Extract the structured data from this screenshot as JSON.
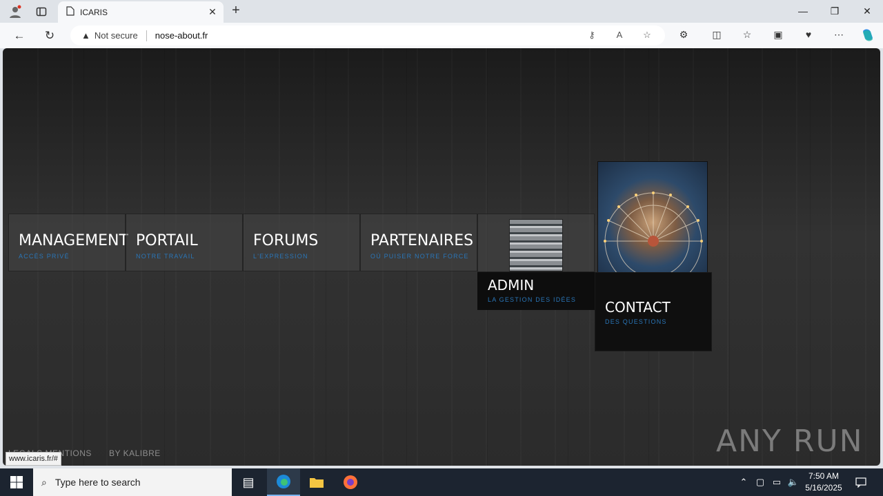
{
  "browser": {
    "tab_title": "ICARIS",
    "new_tab": "+",
    "security_label": "Not secure",
    "url": "nose-about.fr",
    "status_url": "www.icaris.fr/#"
  },
  "menu": {
    "tiles": [
      {
        "title": "MANAGEMENT",
        "subtitle": "ACCÈS PRIVÉ"
      },
      {
        "title": "PORTAIL",
        "subtitle": "NOTRE TRAVAIL"
      },
      {
        "title": "FORUMS",
        "subtitle": "L'EXPRESSION"
      },
      {
        "title": "PARTENAIRES",
        "subtitle": "OÙ PUISER NOTRE FORCE"
      },
      {
        "title": "ADMIN",
        "subtitle": "LA GESTION DES IDÉES"
      },
      {
        "title": "CONTACT",
        "subtitle": "DES QUESTIONS"
      }
    ]
  },
  "footer": {
    "legal": "LEGALS MENTIONS",
    "credit": "BY KALIBRE"
  },
  "watermark": "ANY RUN",
  "taskbar": {
    "search_placeholder": "Type here to search",
    "time": "7:50 AM",
    "date": "5/16/2025"
  },
  "colors": {
    "accent_blue": "#2a76b8",
    "page_bg": "#2b2b2b"
  }
}
